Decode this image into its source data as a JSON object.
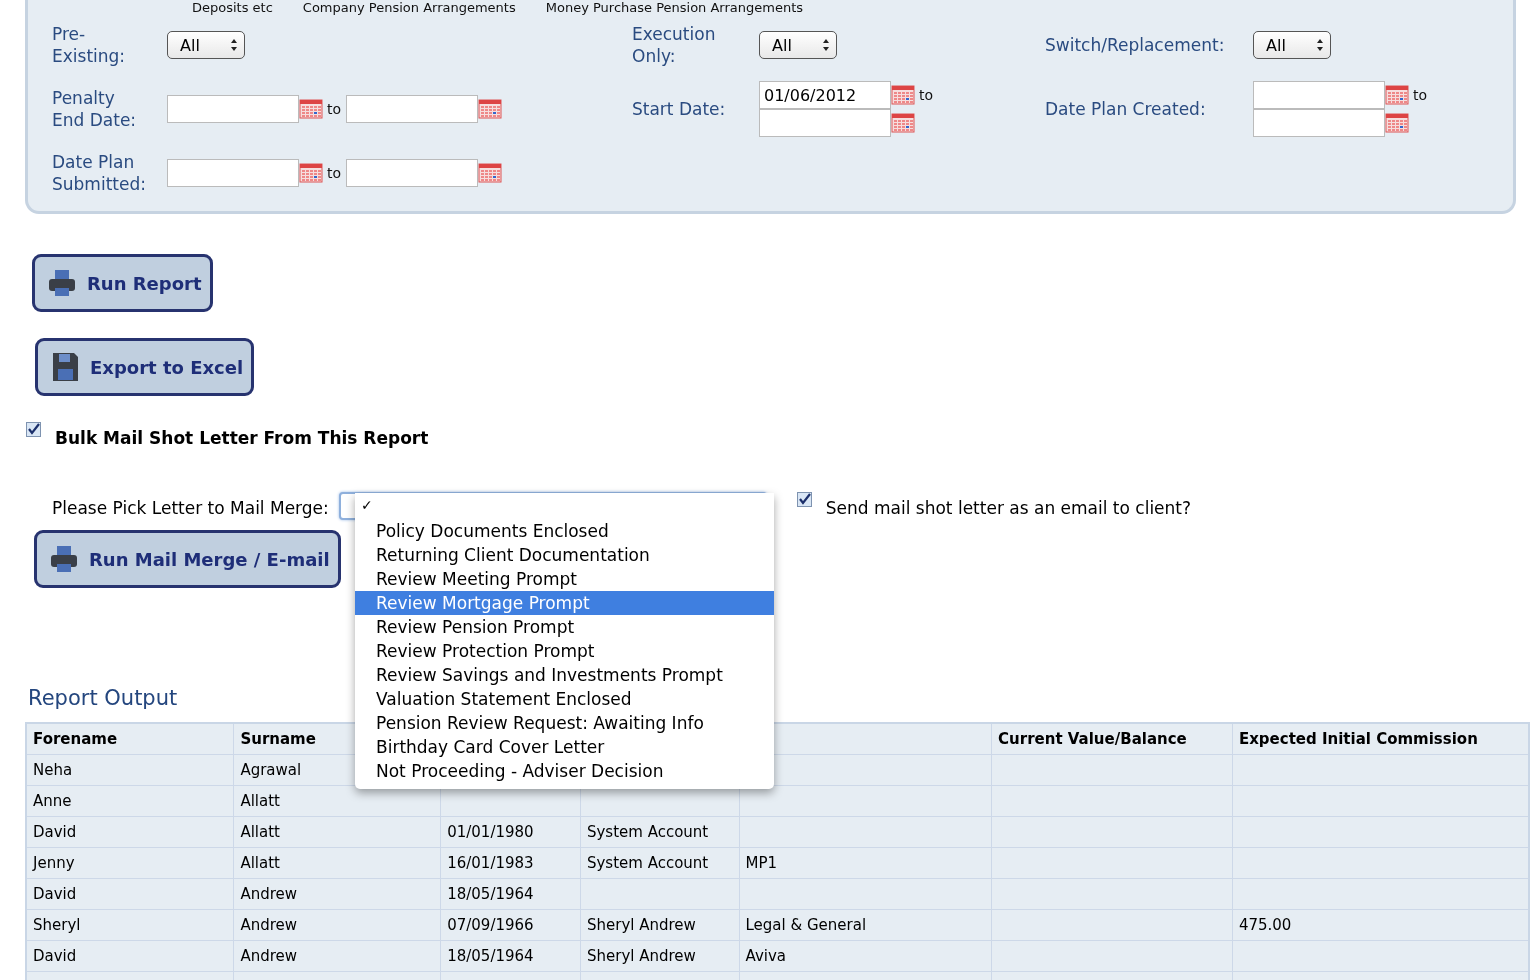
{
  "top_options": [
    "Deposits etc",
    "Company Pension Arrangements",
    "Money Purchase Pension Arrangements"
  ],
  "filters": [
    {
      "kind": "select",
      "label": "Pre-\nExisting:",
      "value": "All"
    },
    {
      "kind": "select",
      "label": "Execution\nOnly:",
      "value": "All"
    },
    {
      "kind": "select",
      "label": "Switch/Replacement:",
      "value": "All"
    },
    {
      "kind": "range",
      "label": "Penalty\nEnd Date:",
      "to_label": "to"
    },
    {
      "kind": "stacked",
      "label": "Start Date:",
      "from": "01/06/2012",
      "to_label": "to"
    },
    {
      "kind": "stacked",
      "label": "Date Plan Created:",
      "to_label": "to"
    },
    {
      "kind": "range",
      "label": "Date Plan\nSubmitted:",
      "to_label": "to"
    }
  ],
  "buttons": [
    {
      "kind": "print",
      "label": "Run Report"
    },
    {
      "kind": "save",
      "label": "Export to Excel"
    }
  ],
  "bulk_mail": {
    "label": "Bulk Mail Shot Letter From This Report",
    "checked": true
  },
  "mail_merge": {
    "label": "Please Pick Letter to Mail Merge:",
    "check_mark": "✓",
    "expanded": true,
    "options": [
      {
        "label": "Policy Documents Enclosed",
        "selected": false
      },
      {
        "label": "Returning Client Documentation",
        "selected": false
      },
      {
        "label": "Review Meeting Prompt",
        "selected": false
      },
      {
        "label": "Review Mortgage Prompt",
        "selected": true
      },
      {
        "label": "Review Pension Prompt",
        "selected": false
      },
      {
        "label": "Review Protection Prompt",
        "selected": false
      },
      {
        "label": "Review Savings and Investments Prompt",
        "selected": false
      },
      {
        "label": "Valuation Statement Enclosed",
        "selected": false
      },
      {
        "label": "Pension Review Request: Awaiting Info",
        "selected": false
      },
      {
        "label": "Birthday Card Cover Letter",
        "selected": false
      },
      {
        "label": "Not Proceeding - Adviser Decision",
        "selected": false
      }
    ],
    "email_option": {
      "label": "Send mail shot letter as an email to client?",
      "checked": true
    },
    "button": {
      "kind": "print",
      "label": "Run Mail Merge / E-mail"
    }
  },
  "report": {
    "title": "Report Output",
    "columns": [
      "Forename",
      "Surname",
      null,
      null,
      null,
      "Current Value/Balance",
      "Expected Initial Commission"
    ],
    "rows": [
      [
        "Neha",
        "Agrawal",
        "",
        "",
        "",
        "",
        ""
      ],
      [
        "Anne",
        "Allatt",
        "",
        "",
        "",
        "",
        ""
      ],
      [
        "David",
        "Allatt",
        "01/01/1980",
        "System Account",
        "",
        "",
        ""
      ],
      [
        "Jenny",
        "Allatt",
        "16/01/1983",
        "System Account",
        "MP1",
        "",
        ""
      ],
      [
        "David",
        "Andrew",
        "18/05/1964",
        "",
        "",
        "",
        ""
      ],
      [
        "Sheryl",
        "Andrew",
        "07/09/1966",
        "Sheryl Andrew",
        "Legal & General",
        "",
        "475.00"
      ],
      [
        "David",
        "Andrew",
        "18/05/1964",
        "Sheryl Andrew",
        "Aviva",
        "",
        ""
      ],
      [
        "",
        "",
        "",
        "",
        "",
        "",
        ""
      ]
    ]
  }
}
